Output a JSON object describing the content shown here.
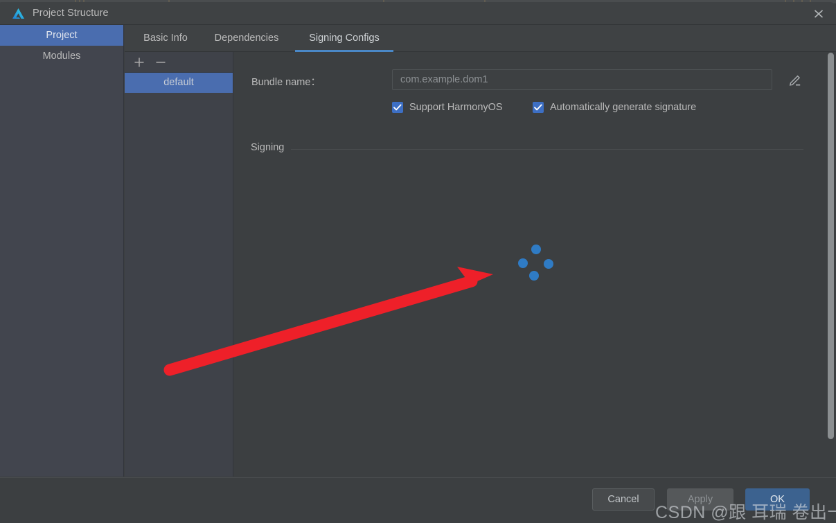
{
  "window": {
    "title": "Project Structure",
    "logo_icon": "deveco-logo-icon",
    "close_icon": "close-icon"
  },
  "sidebar": {
    "items": [
      {
        "label": "Project",
        "selected": true
      },
      {
        "label": "Modules",
        "selected": false
      }
    ]
  },
  "tabs": [
    {
      "label": "Basic Info",
      "active": false
    },
    {
      "label": "Dependencies",
      "active": false
    },
    {
      "label": "Signing Configs",
      "active": true
    }
  ],
  "configs_panel": {
    "add_label": "+",
    "remove_label": "−",
    "add_icon": "plus-icon",
    "remove_icon": "minus-icon",
    "items": [
      {
        "label": "default",
        "selected": true
      }
    ]
  },
  "form": {
    "bundle_name_label": "Bundle name：",
    "bundle_name_value": "",
    "bundle_name_placeholder": "com.example.dom1",
    "edit_icon": "pencil-edit-icon",
    "checkboxes": [
      {
        "label": "Support HarmonyOS",
        "checked": true
      },
      {
        "label": "Automatically generate signature",
        "checked": true
      }
    ],
    "section_title": "Signing",
    "loading_icon": "loading-spinner-icon"
  },
  "footer": {
    "cancel_label": "Cancel",
    "apply_label": "Apply",
    "ok_label": "OK"
  },
  "annotation": {
    "arrow_color": "#ee2029",
    "watermark_text": "CSDN @跟 耳瑞 卷出一片天"
  },
  "colors": {
    "accent_blue": "#4a6daf",
    "tab_underline": "#4a88c7",
    "checkbox_blue": "#3d6fc4",
    "ok_button": "#3c628f",
    "panel_bg": "#3c3f41",
    "sidebar_bg": "#42454e"
  }
}
